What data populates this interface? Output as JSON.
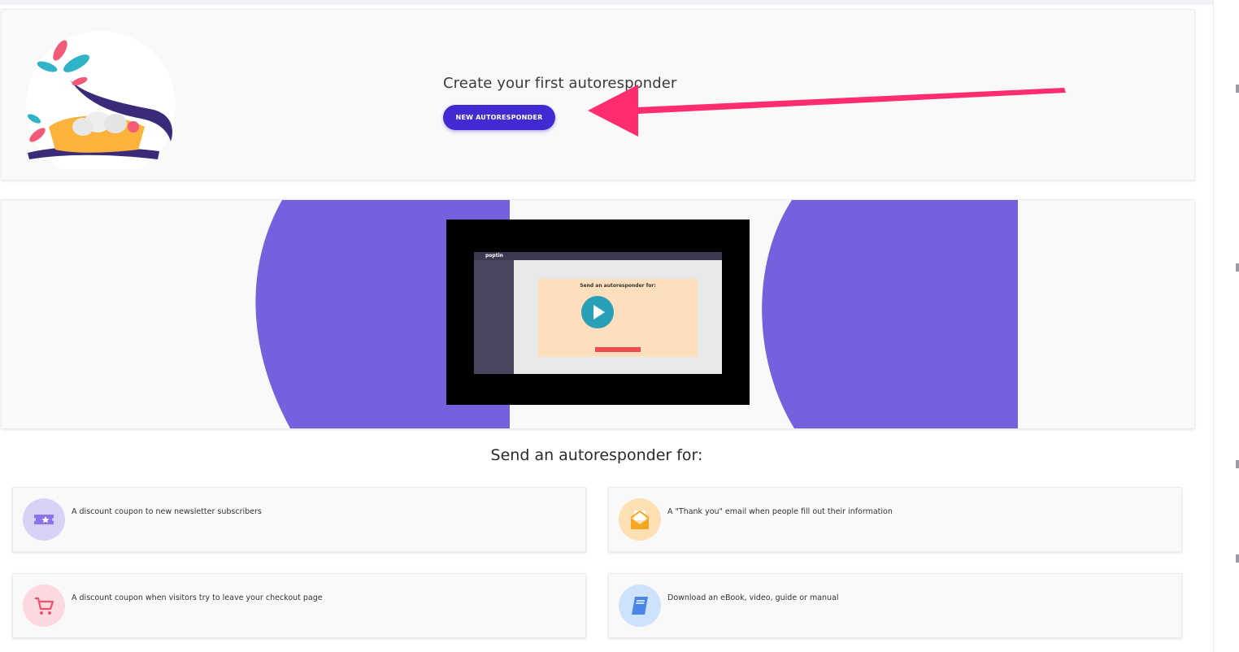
{
  "hero": {
    "title": "Create your first autoresponder",
    "button_label": "NEW AUTORESPONDER"
  },
  "video": {
    "app_brand": "poptin",
    "panel_heading": "Send an autoresponder for:"
  },
  "section": {
    "title": "Send an autoresponder for:"
  },
  "options": [
    {
      "icon": "ticket-star-icon",
      "text": "A discount coupon to new newsletter subscribers"
    },
    {
      "icon": "envelope-open-icon",
      "text": "A \"Thank you\" email when people fill out their information"
    },
    {
      "icon": "shopping-cart-icon",
      "text": "A discount coupon when visitors try to leave your checkout page"
    },
    {
      "icon": "book-icon",
      "text": "Download an eBook, video, guide or manual"
    }
  ],
  "colors": {
    "primary": "#3f2bd1",
    "purple_bg": "#7560de",
    "arrow": "#ff2d6f",
    "card_bg": "#f9f9f9"
  }
}
